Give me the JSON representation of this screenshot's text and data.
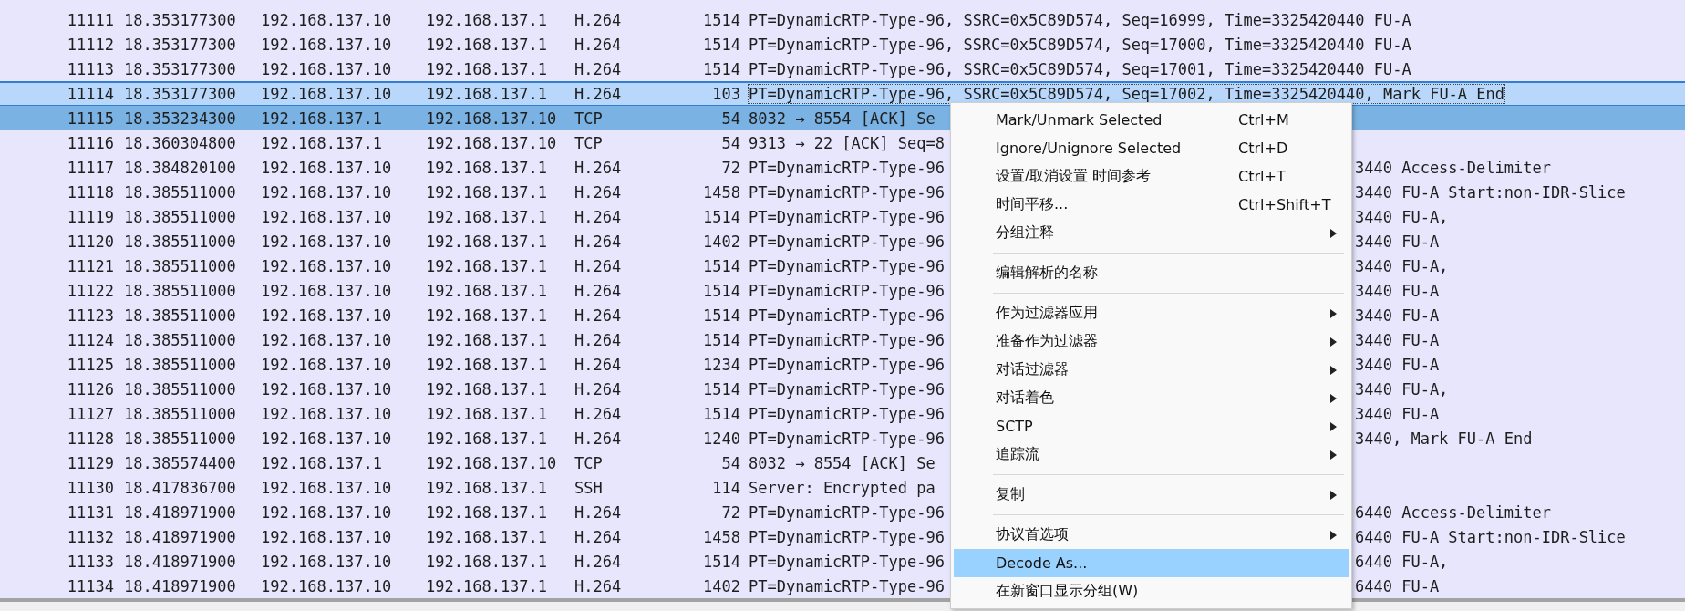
{
  "packet_list": {
    "rows": [
      {
        "no": "11111",
        "time": "18.353177300",
        "source": "192.168.137.10",
        "destination": "192.168.137.1",
        "protocol": "H.264",
        "length": "1514",
        "info": "PT=DynamicRTP-Type-96, SSRC=0x5C89D574, Seq=16999, Time=3325420440 FU-A",
        "selected": false,
        "hovered": false
      },
      {
        "no": "11112",
        "time": "18.353177300",
        "source": "192.168.137.10",
        "destination": "192.168.137.1",
        "protocol": "H.264",
        "length": "1514",
        "info": "PT=DynamicRTP-Type-96, SSRC=0x5C89D574, Seq=17000, Time=3325420440 FU-A",
        "selected": false,
        "hovered": false
      },
      {
        "no": "11113",
        "time": "18.353177300",
        "source": "192.168.137.10",
        "destination": "192.168.137.1",
        "protocol": "H.264",
        "length": "1514",
        "info": "PT=DynamicRTP-Type-96, SSRC=0x5C89D574, Seq=17001, Time=3325420440 FU-A",
        "selected": false,
        "hovered": false
      },
      {
        "no": "11114",
        "time": "18.353177300",
        "source": "192.168.137.10",
        "destination": "192.168.137.1",
        "protocol": "H.264",
        "length": "103",
        "info": "PT=DynamicRTP-Type-96, SSRC=0x5C89D574, Seq=17002, Time=3325420440, Mark FU-A End",
        "selected": false,
        "hovered": true
      },
      {
        "no": "11115",
        "time": "18.353234300",
        "source": "192.168.137.1",
        "destination": "192.168.137.10",
        "protocol": "TCP",
        "length": "54",
        "info": "8032 → 8554 [ACK] Se",
        "selected": true,
        "hovered": false
      },
      {
        "no": "11116",
        "time": "18.360304800",
        "source": "192.168.137.1",
        "destination": "192.168.137.10",
        "protocol": "TCP",
        "length": "54",
        "info": "9313 → 22 [ACK] Seq=8",
        "selected": false,
        "hovered": false
      },
      {
        "no": "11117",
        "time": "18.384820100",
        "source": "192.168.137.10",
        "destination": "192.168.137.1",
        "protocol": "H.264",
        "length": "72",
        "info": "PT=DynamicRTP-Type-96",
        "info_tail": "3440 Access-Delimiter",
        "selected": false,
        "hovered": false
      },
      {
        "no": "11118",
        "time": "18.385511000",
        "source": "192.168.137.10",
        "destination": "192.168.137.1",
        "protocol": "H.264",
        "length": "1458",
        "info": "PT=DynamicRTP-Type-96",
        "info_tail": "3440 FU-A Start:non-IDR-Slice",
        "selected": false,
        "hovered": false
      },
      {
        "no": "11119",
        "time": "18.385511000",
        "source": "192.168.137.10",
        "destination": "192.168.137.1",
        "protocol": "H.264",
        "length": "1514",
        "info": "PT=DynamicRTP-Type-96",
        "info_tail": "3440 FU-A,",
        "selected": false,
        "hovered": false
      },
      {
        "no": "11120",
        "time": "18.385511000",
        "source": "192.168.137.10",
        "destination": "192.168.137.1",
        "protocol": "H.264",
        "length": "1402",
        "info": "PT=DynamicRTP-Type-96",
        "info_tail": "3440 FU-A",
        "selected": false,
        "hovered": false
      },
      {
        "no": "11121",
        "time": "18.385511000",
        "source": "192.168.137.10",
        "destination": "192.168.137.1",
        "protocol": "H.264",
        "length": "1514",
        "info": "PT=DynamicRTP-Type-96",
        "info_tail": "3440 FU-A,",
        "selected": false,
        "hovered": false
      },
      {
        "no": "11122",
        "time": "18.385511000",
        "source": "192.168.137.10",
        "destination": "192.168.137.1",
        "protocol": "H.264",
        "length": "1514",
        "info": "PT=DynamicRTP-Type-96",
        "info_tail": "3440 FU-A",
        "selected": false,
        "hovered": false
      },
      {
        "no": "11123",
        "time": "18.385511000",
        "source": "192.168.137.10",
        "destination": "192.168.137.1",
        "protocol": "H.264",
        "length": "1514",
        "info": "PT=DynamicRTP-Type-96",
        "info_tail": "3440 FU-A",
        "selected": false,
        "hovered": false
      },
      {
        "no": "11124",
        "time": "18.385511000",
        "source": "192.168.137.10",
        "destination": "192.168.137.1",
        "protocol": "H.264",
        "length": "1514",
        "info": "PT=DynamicRTP-Type-96",
        "info_tail": "3440 FU-A",
        "selected": false,
        "hovered": false
      },
      {
        "no": "11125",
        "time": "18.385511000",
        "source": "192.168.137.10",
        "destination": "192.168.137.1",
        "protocol": "H.264",
        "length": "1234",
        "info": "PT=DynamicRTP-Type-96",
        "info_tail": "3440 FU-A",
        "selected": false,
        "hovered": false
      },
      {
        "no": "11126",
        "time": "18.385511000",
        "source": "192.168.137.10",
        "destination": "192.168.137.1",
        "protocol": "H.264",
        "length": "1514",
        "info": "PT=DynamicRTP-Type-96",
        "info_tail": "3440 FU-A,",
        "selected": false,
        "hovered": false
      },
      {
        "no": "11127",
        "time": "18.385511000",
        "source": "192.168.137.10",
        "destination": "192.168.137.1",
        "protocol": "H.264",
        "length": "1514",
        "info": "PT=DynamicRTP-Type-96",
        "info_tail": "3440 FU-A",
        "selected": false,
        "hovered": false
      },
      {
        "no": "11128",
        "time": "18.385511000",
        "source": "192.168.137.10",
        "destination": "192.168.137.1",
        "protocol": "H.264",
        "length": "1240",
        "info": "PT=DynamicRTP-Type-96",
        "info_tail": "3440, Mark FU-A End",
        "selected": false,
        "hovered": false
      },
      {
        "no": "11129",
        "time": "18.385574400",
        "source": "192.168.137.1",
        "destination": "192.168.137.10",
        "protocol": "TCP",
        "length": "54",
        "info": "8032 → 8554 [ACK] Se",
        "selected": false,
        "hovered": false
      },
      {
        "no": "11130",
        "time": "18.417836700",
        "source": "192.168.137.10",
        "destination": "192.168.137.1",
        "protocol": "SSH",
        "length": "114",
        "info": "Server: Encrypted pa",
        "selected": false,
        "hovered": false
      },
      {
        "no": "11131",
        "time": "18.418971900",
        "source": "192.168.137.10",
        "destination": "192.168.137.1",
        "protocol": "H.264",
        "length": "72",
        "info": "PT=DynamicRTP-Type-96",
        "info_tail": "6440 Access-Delimiter",
        "selected": false,
        "hovered": false
      },
      {
        "no": "11132",
        "time": "18.418971900",
        "source": "192.168.137.10",
        "destination": "192.168.137.1",
        "protocol": "H.264",
        "length": "1458",
        "info": "PT=DynamicRTP-Type-96",
        "info_tail": "6440 FU-A Start:non-IDR-Slice",
        "selected": false,
        "hovered": false
      },
      {
        "no": "11133",
        "time": "18.418971900",
        "source": "192.168.137.10",
        "destination": "192.168.137.1",
        "protocol": "H.264",
        "length": "1514",
        "info": "PT=DynamicRTP-Type-96",
        "info_tail": "6440 FU-A,",
        "selected": false,
        "hovered": false
      },
      {
        "no": "11134",
        "time": "18.418971900",
        "source": "192.168.137.10",
        "destination": "192.168.137.1",
        "protocol": "H.264",
        "length": "1402",
        "info": "PT=DynamicRTP-Type-96",
        "info_tail": "6440 FU-A",
        "selected": false,
        "hovered": false
      }
    ]
  },
  "context_menu": {
    "items": [
      {
        "kind": "item",
        "label": "Mark/Unmark Selected",
        "shortcut": "Ctrl+M",
        "submenu": false,
        "selected": false
      },
      {
        "kind": "item",
        "label": "Ignore/Unignore Selected",
        "shortcut": "Ctrl+D",
        "submenu": false,
        "selected": false
      },
      {
        "kind": "item",
        "label": "设置/取消设置 时间参考",
        "shortcut": "Ctrl+T",
        "submenu": false,
        "selected": false
      },
      {
        "kind": "item",
        "label": "时间平移...",
        "shortcut": "Ctrl+Shift+T",
        "submenu": false,
        "selected": false
      },
      {
        "kind": "item",
        "label": "分组注释",
        "submenu": true,
        "selected": false
      },
      {
        "kind": "separator"
      },
      {
        "kind": "item",
        "label": "编辑解析的名称",
        "submenu": false,
        "selected": false
      },
      {
        "kind": "separator"
      },
      {
        "kind": "item",
        "label": "作为过滤器应用",
        "submenu": true,
        "selected": false
      },
      {
        "kind": "item",
        "label": "准备作为过滤器",
        "submenu": true,
        "selected": false
      },
      {
        "kind": "item",
        "label": "对话过滤器",
        "submenu": true,
        "selected": false
      },
      {
        "kind": "item",
        "label": "对话着色",
        "submenu": true,
        "selected": false
      },
      {
        "kind": "item",
        "label": "SCTP",
        "submenu": true,
        "selected": false
      },
      {
        "kind": "item",
        "label": "追踪流",
        "submenu": true,
        "selected": false
      },
      {
        "kind": "separator"
      },
      {
        "kind": "item",
        "label": "复制",
        "submenu": true,
        "selected": false
      },
      {
        "kind": "separator"
      },
      {
        "kind": "item",
        "label": "协议首选项",
        "submenu": true,
        "selected": false
      },
      {
        "kind": "item",
        "label": "Decode As...",
        "submenu": false,
        "selected": true
      },
      {
        "kind": "item",
        "label": "在新窗口显示分组(W)",
        "submenu": false,
        "selected": false
      }
    ]
  }
}
